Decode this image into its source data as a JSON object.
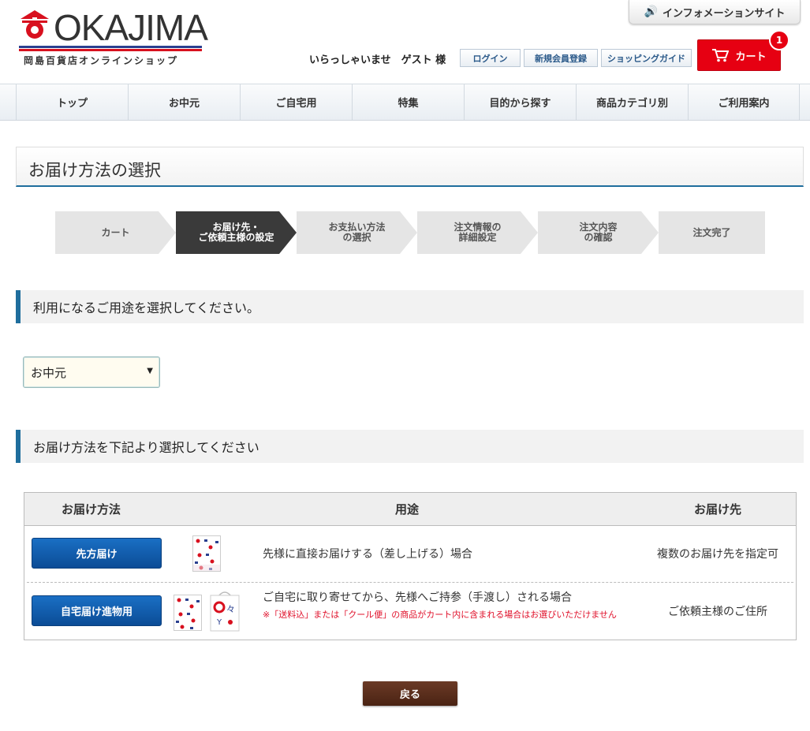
{
  "header": {
    "logo_text": "OKAJIMA",
    "logo_subtitle": "岡島百貨店オンラインショップ",
    "info_site_label": "インフォメーションサイト",
    "welcome": "いらっしゃいませ　ゲスト 様",
    "login_label": "ログイン",
    "register_label": "新規会員登録",
    "guide_label": "ショッピングガイド",
    "cart_label": "カート",
    "cart_count": "1"
  },
  "nav": {
    "items": [
      "トップ",
      "お中元",
      "ご自宅用",
      "特集",
      "目的から探す",
      "商品カテゴリ別",
      "ご利用案内"
    ]
  },
  "page_title": "お届け方法の選択",
  "steps": [
    {
      "label": "カート"
    },
    {
      "label_line1": "お届け先・",
      "label_line2": "ご依頼主様の設定"
    },
    {
      "label_line1": "お支払い方法",
      "label_line2": "の選択"
    },
    {
      "label_line1": "注文情報の",
      "label_line2": "詳細設定"
    },
    {
      "label_line1": "注文内容",
      "label_line2": "の確認"
    },
    {
      "label": "注文完了"
    }
  ],
  "section1_title": "利用になるご用途を選択してください。",
  "purpose_select": {
    "selected": "お中元"
  },
  "section2_title": "お届け方法を下記より選択してください",
  "table": {
    "headers": [
      "お届け方法",
      "用途",
      "お届け先"
    ],
    "rows": [
      {
        "button": "先方届け",
        "description": "先様に直接お届けする（差し上げる）場合",
        "note": "",
        "destination": "複数のお届け先を指定可"
      },
      {
        "button": "自宅届け進物用",
        "description": "ご自宅に取り寄せてから、先様へご持参（手渡し）される場合",
        "note": "※「送料込」または「クール便」の商品がカート内に含まれる場合はお選びいただけません",
        "destination": "ご依頼主様のご住所"
      }
    ]
  },
  "back_label": "戻る",
  "colors": {
    "accent": "#1f6e9d",
    "cart_red": "#e60012",
    "button_blue": "#0b4c96",
    "back_brown": "#4a2313"
  }
}
